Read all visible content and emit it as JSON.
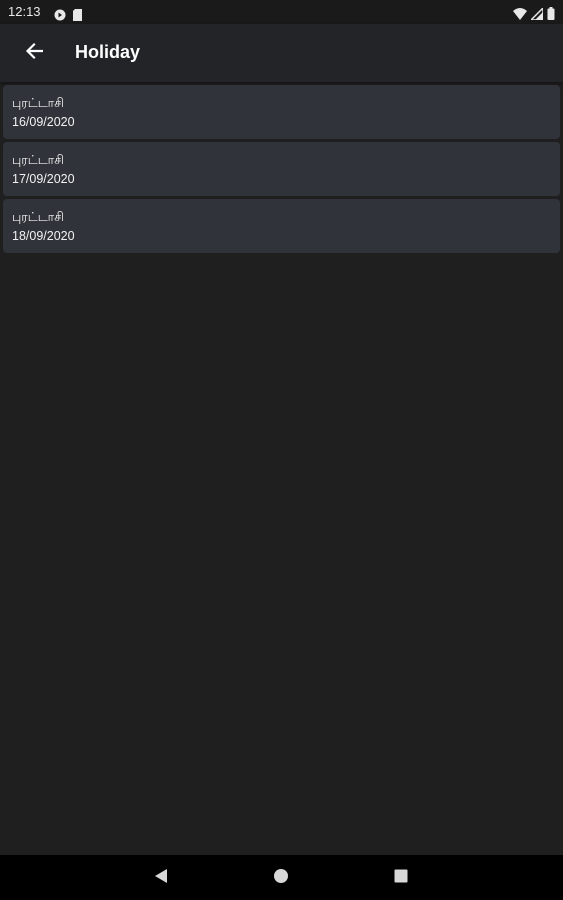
{
  "status_bar": {
    "time": "12:13",
    "left_icons": [
      "media-icon",
      "sd-card-icon"
    ],
    "right_icons": [
      "wifi-icon",
      "signal-icon",
      "battery-icon"
    ]
  },
  "app_bar": {
    "title": "Holiday",
    "back_icon": "arrow-left-icon"
  },
  "holidays": [
    {
      "name": "புரட்டாசி",
      "date": "16/09/2020"
    },
    {
      "name": "புரட்டாசி",
      "date": "17/09/2020"
    },
    {
      "name": "புரட்டாசி",
      "date": "18/09/2020"
    }
  ],
  "nav_bar": {
    "buttons": [
      "back-triangle-icon",
      "home-circle-icon",
      "recents-square-icon"
    ]
  },
  "colors": {
    "background": "#1f1f1f",
    "app_bar": "#232427",
    "card": "#30333a",
    "text": "#ffffff"
  }
}
